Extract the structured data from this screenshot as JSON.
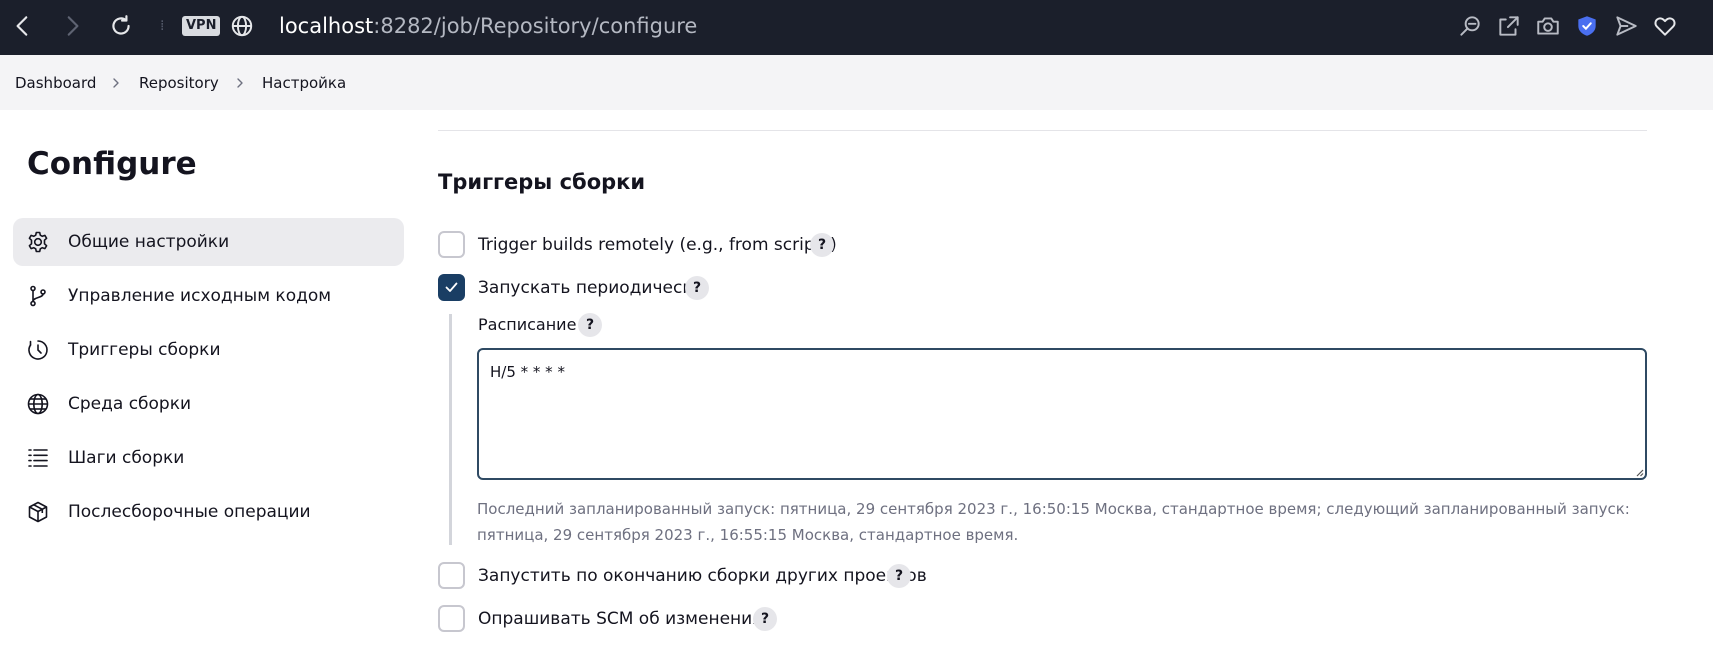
{
  "browser": {
    "vpn_label": "VPN",
    "url_host": "localhost",
    "url_path": ":8282/job/Repository/configure"
  },
  "breadcrumb": {
    "items": [
      "Dashboard",
      "Repository",
      "Настройка"
    ]
  },
  "sidebar": {
    "title": "Configure",
    "items": [
      {
        "label": "Общие настройки",
        "icon": "gear-icon",
        "active": true
      },
      {
        "label": "Управление исходным кодом",
        "icon": "branch-icon",
        "active": false
      },
      {
        "label": "Триггеры сборки",
        "icon": "clock-icon",
        "active": false
      },
      {
        "label": "Среда сборки",
        "icon": "globe-icon",
        "active": false
      },
      {
        "label": "Шаги сборки",
        "icon": "list-icon",
        "active": false
      },
      {
        "label": "Послесборочные операции",
        "icon": "package-icon",
        "active": false
      }
    ]
  },
  "main": {
    "section_title": "Триггеры сборки",
    "help_symbol": "?",
    "triggers": [
      {
        "label": "Trigger builds remotely (e.g., from scripts)",
        "checked": false
      },
      {
        "label": "Запускать периодически",
        "checked": true
      },
      {
        "label": "Запустить по окончанию сборки других проектов",
        "checked": false
      },
      {
        "label": "Опрашивать SCM об изменениях",
        "checked": false
      }
    ],
    "schedule": {
      "label": "Расписание",
      "value": "H/5 * * * *",
      "hint": "Последний запланированный запуск: пятница, 29 сентября 2023 г., 16:50:15 Москва, стандартное время; следующий запланированный запуск: пятница, 29 сентября 2023 г., 16:55:15 Москва, стандартное время."
    }
  },
  "colors": {
    "browser_bar": "#1b1f2b",
    "accent": "#1a3e64",
    "hint_text": "#6e7080"
  }
}
